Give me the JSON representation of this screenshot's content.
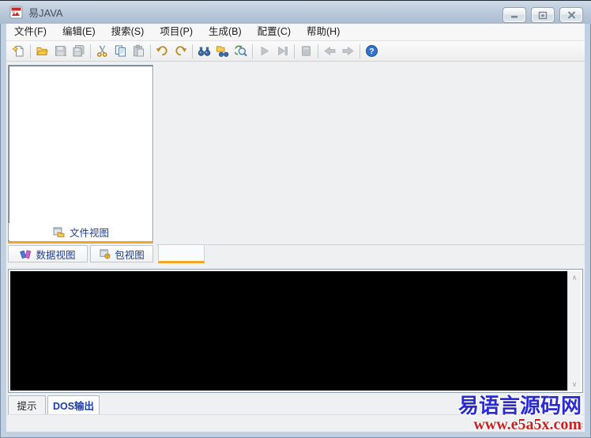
{
  "window": {
    "title": "易JAVA",
    "controls": {
      "minimize": "minimize",
      "maximize": "maximize",
      "close": "close"
    }
  },
  "menu": {
    "items": [
      {
        "label": "文件(F)"
      },
      {
        "label": "编辑(E)"
      },
      {
        "label": "搜索(S)"
      },
      {
        "label": "项目(P)"
      },
      {
        "label": "生成(B)"
      },
      {
        "label": "配置(C)"
      },
      {
        "label": "帮助(H)"
      }
    ]
  },
  "toolbar": {
    "buttons": [
      {
        "name": "new-file",
        "enabled": true
      },
      {
        "name": "open-folder",
        "enabled": true
      },
      {
        "name": "save",
        "enabled": false
      },
      {
        "name": "save-all",
        "enabled": false
      },
      {
        "name": "cut",
        "enabled": true
      },
      {
        "name": "copy",
        "enabled": true
      },
      {
        "name": "paste",
        "enabled": false
      },
      {
        "name": "undo",
        "enabled": true
      },
      {
        "name": "redo",
        "enabled": true
      },
      {
        "name": "find",
        "enabled": true
      },
      {
        "name": "find-in-files",
        "enabled": true
      },
      {
        "name": "find-replace",
        "enabled": true
      },
      {
        "name": "run",
        "enabled": false
      },
      {
        "name": "step",
        "enabled": false
      },
      {
        "name": "document",
        "enabled": false
      },
      {
        "name": "back",
        "enabled": false
      },
      {
        "name": "forward",
        "enabled": false
      },
      {
        "name": "help",
        "enabled": true
      }
    ]
  },
  "left_panel": {
    "view_label": "文件视图",
    "tree_content": "",
    "bottom_tabs": [
      {
        "label": "数据视图"
      },
      {
        "label": "包视图"
      }
    ]
  },
  "editor": {
    "tab_label": ""
  },
  "console": {
    "text": ""
  },
  "scrollbar": {
    "up": "∧",
    "down": "∨"
  },
  "output_tabs": [
    {
      "label": "提示",
      "active": false
    },
    {
      "label": "DOS输出",
      "active": true
    }
  ],
  "watermark": {
    "site": "易语言源码网",
    "url": "www.e5a5x.com"
  },
  "colors": {
    "accent_orange": "#EFA726",
    "titlebar": "#B9C8DA",
    "console_bg": "#000000",
    "watermark_blue": "#2B2BD6",
    "watermark_red": "#CC2020"
  }
}
